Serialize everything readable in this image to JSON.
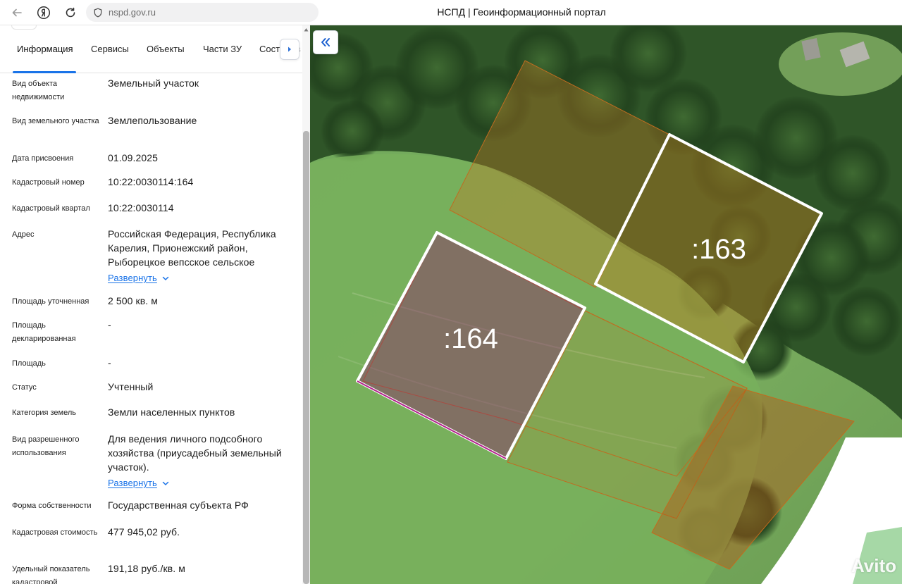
{
  "browser": {
    "url": "nspd.gov.ru",
    "title": "НСПД | Геоинформационный портал"
  },
  "tabs": [
    "Информация",
    "Сервисы",
    "Объекты",
    "Части ЗУ",
    "Сост"
  ],
  "tab_overflow_suffix": "в",
  "fields": {
    "obj_type": {
      "label": "Вид объекта недвижимости",
      "value": "Земельный участок"
    },
    "land_type": {
      "label": "Вид земельного участка",
      "value": "Землепользование"
    },
    "date": {
      "label": "Дата присвоения",
      "value": "01.09.2025"
    },
    "cad_num": {
      "label": "Кадастровый номер",
      "value": "10:22:0030114:164"
    },
    "cad_quarter": {
      "label": "Кадастровый квартал",
      "value": "10:22:0030114"
    },
    "address": {
      "label": "Адрес",
      "value": "Российская Федерация, Республика Карелия, Прионежский район, Рыборецкое вепсское сельское",
      "expand": "Развернуть"
    },
    "area_precise": {
      "label": "Площадь уточненная",
      "value": "2 500 кв. м"
    },
    "area_declared": {
      "label": "Площадь декларированная",
      "value": "-"
    },
    "area": {
      "label": "Площадь",
      "value": "-"
    },
    "status": {
      "label": "Статус",
      "value": "Учтенный"
    },
    "category": {
      "label": "Категория земель",
      "value": "Земли населенных пунктов"
    },
    "permitted_use": {
      "label": "Вид разрешенного использования",
      "value": "Для ведения личного подсобного хозяйства (приусадебный земельный участок).",
      "expand": "Развернуть"
    },
    "ownership": {
      "label": "Форма собственности",
      "value": "Государственная субъекта РФ"
    },
    "cad_value": {
      "label": "Кадастровая стоимость",
      "value": "477 945,02 руб."
    },
    "specific": {
      "label": "Удельный показатель кадастровой",
      "value": "191,18 руб./кв. м"
    }
  },
  "map": {
    "parcel_a_label": ":164",
    "parcel_b_label": ":163",
    "watermark": "Avito"
  },
  "colors": {
    "accent": "#1a73e8",
    "parcel_selected": "#8c2a6a",
    "parcel_outline": "#ffffff",
    "parcel_other": "#b8651c"
  },
  "icons": {
    "back": "arrow-left-icon",
    "yandex": "yandex-logo-icon",
    "reload": "reload-icon",
    "shield": "shield-icon",
    "collapse": "double-chevron-left-icon",
    "chevron": "chevron-down-icon"
  }
}
